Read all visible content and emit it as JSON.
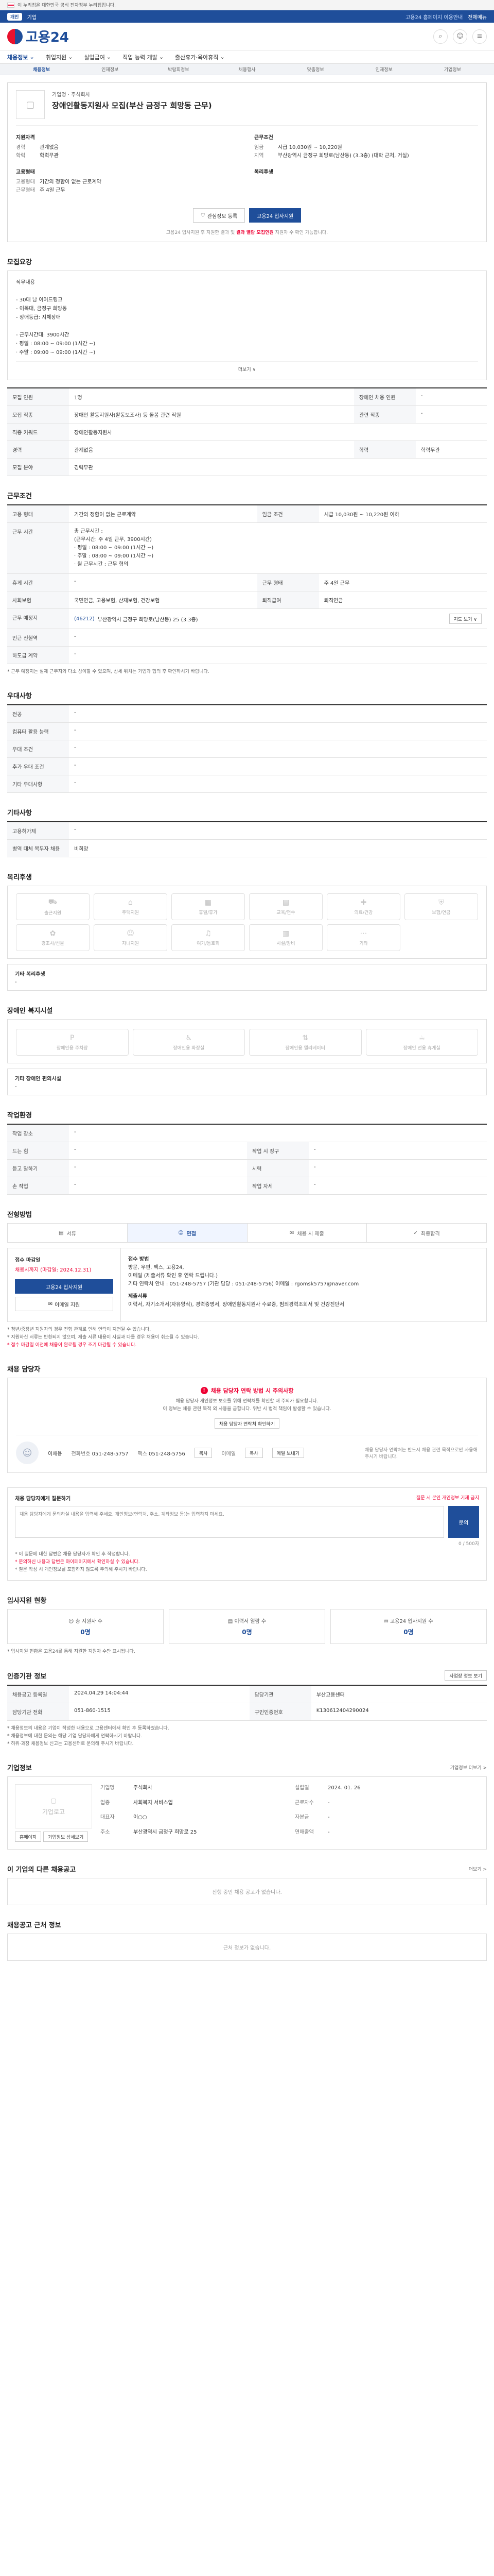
{
  "gov_banner": {
    "text": "이 누리집은 대한민국 공식 전자정부 누리집입니다."
  },
  "top_util": {
    "badge": "개인",
    "badge2": "기업",
    "right_text": "고용24 홈페이지 이용안내",
    "link": "전체메뉴"
  },
  "header": {
    "logo_text": "고용24"
  },
  "gnb": {
    "items": [
      "채용정보",
      "취업지원",
      "실업급여",
      "직업 능력 개발",
      "출산휴가·육아휴직"
    ]
  },
  "lnb": {
    "items": [
      "채용정보",
      "인재정보",
      "박람회정보",
      "채용행사",
      "맞춤정보",
      "인재정보",
      "기업정보"
    ]
  },
  "summary": {
    "company_label": "기업명",
    "company_name": "주식회사",
    "title": "장애인활동지원사 모집(부산 금정구 희망동 근무)",
    "blocks": [
      {
        "head": "지원자격",
        "rows": [
          {
            "k": "경력",
            "v": "관계없음"
          },
          {
            "k": "학력",
            "v": "학력무관"
          }
        ]
      },
      {
        "head": "근무조건",
        "rows": [
          {
            "k": "임금",
            "v": "시급 10,030원 ~ 10,220원"
          },
          {
            "k": "지역",
            "v": "부산광역시 금정구 희망로(남산동) (3.3층) (대학 근처, 거실)"
          }
        ]
      },
      {
        "head": "고용형태",
        "rows": [
          {
            "k": "고용형태",
            "v": "기간의 정함이 없는 근로계약"
          },
          {
            "k": "근무형태",
            "v": "주 4일 근무"
          }
        ]
      },
      {
        "head": "복리후생",
        "rows": [
          {
            "k": "",
            "v": ""
          }
        ]
      }
    ],
    "btn_save": "관심정보 등록",
    "btn_apply": "고용24 입사지원",
    "note_pre": "고용24 입사지원 후 지원한 결과 및 ",
    "note_red": "결과 열람 모집인원",
    "note_post": " 지원자 수 확인 가능합니다."
  },
  "recruit": {
    "title": "모집요강",
    "lines": [
      "직무내용",
      "",
      "- 30대 남 이어드링크",
      "- 이목대, 금정구 희망동",
      "- 장애등급: 지체장애",
      "",
      "- 근무시간대: 3900시간",
      "  · 평일 : 08:00 ~ 09:00 (1시간 ~)",
      "  · 주말 : 09:00 ~ 09:00 (1시간 ~)"
    ],
    "more": "더보기 ∨"
  },
  "recruit_table": [
    [
      {
        "k": "모집 인원",
        "v": "1명"
      },
      {
        "k": "장애인 채용 인원",
        "v": "-"
      }
    ],
    [
      {
        "k": "모집 직종",
        "v": "장애인 활동지원사(활동보조사) 등 돌봄 관련 직원"
      },
      {
        "k": "관련 직종",
        "v": "-"
      }
    ],
    [
      {
        "k": "직종 키워드",
        "v": "장애인활동지원사"
      },
      {
        "k": "",
        "v": ""
      }
    ],
    [
      {
        "k": "경력",
        "v": "관계없음"
      },
      {
        "k": "학력",
        "v": "학력무관"
      }
    ],
    [
      {
        "k": "모집 분야",
        "v": "경력무관"
      },
      {
        "k": "",
        "v": ""
      }
    ]
  ],
  "work": {
    "title": "근무조건",
    "row1": [
      {
        "k": "고용 형태",
        "v": "기간의 정함이 없는 근로계약"
      },
      {
        "k": "임금 조건",
        "v": "시급 10,030원 ~ 10,220원 이하"
      }
    ],
    "time_label": "근무 시간",
    "time_lines": [
      "총 근무시간 :",
      "(근무시간: 주 4일 근무, 3900시간)",
      "· 평일 : 08:00 ~ 09:00 (1시간 ~)",
      "· 주말 : 08:00 ~ 09:00 (1시간 ~)",
      "· 월 근무시간 : 근무 협의"
    ],
    "row3": [
      {
        "k": "휴게 시간",
        "v": "-"
      },
      {
        "k": "근무 형태",
        "v": "주 4일 근무"
      }
    ],
    "row4": [
      {
        "k": "사회보험",
        "v": "국민연금, 고용보험, 산재보험, 건강보험"
      },
      {
        "k": "퇴직급여",
        "v": "퇴직연금"
      }
    ],
    "location_label": "근무 예정지",
    "location_zip": "(46212)",
    "location_addr": "부산광역시 금정구 희망로(남산동) 25 (3.3층)",
    "map_btn": "지도 보기 ∨",
    "nearby_label": "인근 전철역",
    "nearby": "-",
    "wage_label": "하도급 계약",
    "wage": "-",
    "note": "* 근무 예정지는 실제 근무지와 다소 상이할 수 있으며, 상세 위치는 기업과 협의 후 확인하시기 바랍니다."
  },
  "disability": {
    "title": "우대사항",
    "rows": [
      {
        "k": "전공",
        "v": "-"
      },
      {
        "k": "컴퓨터 활용 능력",
        "v": "-"
      },
      {
        "k": "우대 조건",
        "v": "-"
      },
      {
        "k": "추가 우대 조건",
        "v": "-"
      },
      {
        "k": "기타 우대사항",
        "v": "-"
      }
    ]
  },
  "etc": {
    "title": "기타사항",
    "rows": [
      {
        "k": "고용허가제",
        "v": "-"
      },
      {
        "k": "병역 대체 복무자 채용",
        "v": "비희망"
      }
    ]
  },
  "welfare": {
    "title": "복리후생",
    "items": [
      "출근지원",
      "주택지원",
      "휴일/휴가",
      "교육/연수",
      "의료/건강",
      "보험/연금",
      "경조사/선물",
      "자녀지원",
      "여가/동호회",
      "시설/장비",
      "기타"
    ],
    "sub_title": "기타 복리후생",
    "sub_value": "-"
  },
  "disabled_welfare": {
    "title": "장애인 복지시설",
    "items": [
      "장애인용 주차장",
      "장애인용 화장실",
      "장애인용 엘리베이터",
      "장애인 전용 휴게실"
    ],
    "sub_title": "기타 장애인 편의시설",
    "sub_value": "-"
  },
  "env": {
    "title": "작업환경",
    "rows": [
      [
        {
          "k": "작업 장소",
          "v": "-"
        },
        {
          "k": "",
          "v": ""
        }
      ],
      [
        {
          "k": "드는 힘",
          "v": "-"
        },
        {
          "k": "작업 시 장구",
          "v": "-"
        }
      ],
      [
        {
          "k": "듣고 말하기",
          "v": "-"
        },
        {
          "k": "시력",
          "v": "-"
        }
      ],
      [
        {
          "k": "손 작업",
          "v": "-"
        },
        {
          "k": "작업 자세",
          "v": "-"
        }
      ]
    ]
  },
  "process": {
    "title": "전형방법",
    "steps": [
      "서류",
      "면접",
      "채용 시 제출",
      "최종합격"
    ],
    "apply_lbl": "접수 마감일",
    "apply_red": "채용시까지 (마감일: 2024.12.31)",
    "apply_btn1": "고용24 입사지원",
    "apply_btn2": "이메일 지원",
    "right_lbl": "접수 방법",
    "right_lines": [
      "방문, 우편, 팩스, 고용24,",
      "이메일 (제출서류 확인 후 연락 드립니다.)",
      "기타 연락처 안내 : 051-248-5757 (기관 담당 : 051-248-5756) 이메일 : rgomsk5757@naver.com",
      "제출서류",
      "이력서, 자기소개서(자유양식), 경력증명서, 장애인활동지원사 수료증, 범죄경력조회서 및 건강진단서"
    ],
    "bullets": [
      "* 청년/중장년 지원자의 경우 전형 관계로 인해 연락이 지연될 수 있습니다.",
      "* 지원하신 서류는 반환되지 않으며, 제출 서류 내용이 사실과 다를 경우 채용이 취소될 수 있습니다.",
      "* 접수 마감일 이전에 채용이 완료될 경우 조기 마감될 수 있습니다."
    ]
  },
  "contact": {
    "title": "채용 담당자",
    "warn_red": "채용 담당자 연락 방법 시 주의사항",
    "desc": [
      "채용 담당자 개인정보 보호를 위해 연락처를 확인할 때 주의가 필요합니다.",
      "이 정보는 채용 관련 목적 외 사용을 금합니다. 위반 시 법적 책임이 발생할 수 있습니다."
    ],
    "check_btn": "채용 담당자 연락처 확인하기",
    "name_label": "이채용",
    "phone_label": "전화번호",
    "phone": "051-248-5757",
    "fax_label": "팩스",
    "fax": "051-248-5756",
    "email_label": "이메일",
    "btn_copy": "복사",
    "btn_copy2": "복사",
    "btn_mail": "메일 보내기",
    "right_note": "채용 담당자 연락처는 반드시 채용 관련 목적으로만 사용해 주시기 바랍니다."
  },
  "inquiry": {
    "title": "채용 담당자에게 질문하기",
    "red": "질문 시 본인 개인정보 기재 금지",
    "placeholder": "채용 담당자에게 문의하실 내용을 입력해 주세요. 개인정보(연락처, 주소, 계좌정보 등)는 입력하지 마세요.",
    "btn": "문의",
    "bullets": [
      "* 이 질문에 대한 답변은 채용 담당자가 확인 후 작성합니다.",
      "* 문의하신 내용과 답변은 마이페이지에서 확인하실 수 있습니다.",
      "* 질문 작성 시 개인정보를 포함하지 않도록 주의해 주시기 바랍니다."
    ],
    "count": "0 / 500자"
  },
  "stats": {
    "title": "입사지원 현황",
    "items": [
      {
        "l": "총 지원자 수",
        "v": "0명"
      },
      {
        "l": "이력서 열람 수",
        "v": "0명"
      },
      {
        "l": "고용24 입사지원 수",
        "v": "0명"
      }
    ],
    "note": "* 입사지원 현황은 고용24를 통해 지원한 지원자 수만 표시됩니다."
  },
  "agency": {
    "title": "인증기관 정보",
    "btn": "사업장 정보 보기",
    "rows": [
      [
        {
          "k": "채용공고 등록일",
          "v": "2024.04.29 14:04:44"
        },
        {
          "k": "담당기관",
          "v": "부산고용센터"
        }
      ],
      [
        {
          "k": "담당기관 전화",
          "v": "051-860-1515"
        },
        {
          "k": "구인인증번호",
          "v": "K130612404290024"
        }
      ]
    ],
    "notes": [
      "* 채용정보의 내용은 기업이 작성한 내용으로 고용센터에서 확인 후 등록하였습니다.",
      "* 채용정보에 대한 문의는 해당 기업 담당자에게 연락하시기 바랍니다.",
      "* 허위·과장 채용정보 신고는 고용센터로 문의해 주시기 바랍니다."
    ]
  },
  "company": {
    "title": "기업정보",
    "more": "기업정보 더보기 >",
    "logo_caption": "기업로고",
    "rows": [
      {
        "k": "기업명",
        "v": "주식회사"
      },
      {
        "k": "업종",
        "v": "사회복지 서비스업"
      },
      {
        "k": "대표자",
        "v": "이○○"
      },
      {
        "k": "주소",
        "v": "부산광역시 금정구 희망로 25"
      },
      {
        "k": "설립일",
        "v": "2024. 01. 26"
      },
      {
        "k": "근로자수",
        "v": "-"
      },
      {
        "k": "자본금",
        "v": "-"
      },
      {
        "k": "연매출액",
        "v": "-"
      }
    ],
    "btn_home": "홈페이지",
    "btn_detail": "기업정보 상세보기"
  },
  "other_jobs": {
    "title": "이 기업의 다른 채용공고",
    "more": "더보기 >",
    "empty": "진행 중인 채용 공고가 없습니다."
  },
  "nearby_jobs": {
    "title": "채용공고 근처 정보",
    "empty": "근처 정보가 없습니다."
  }
}
